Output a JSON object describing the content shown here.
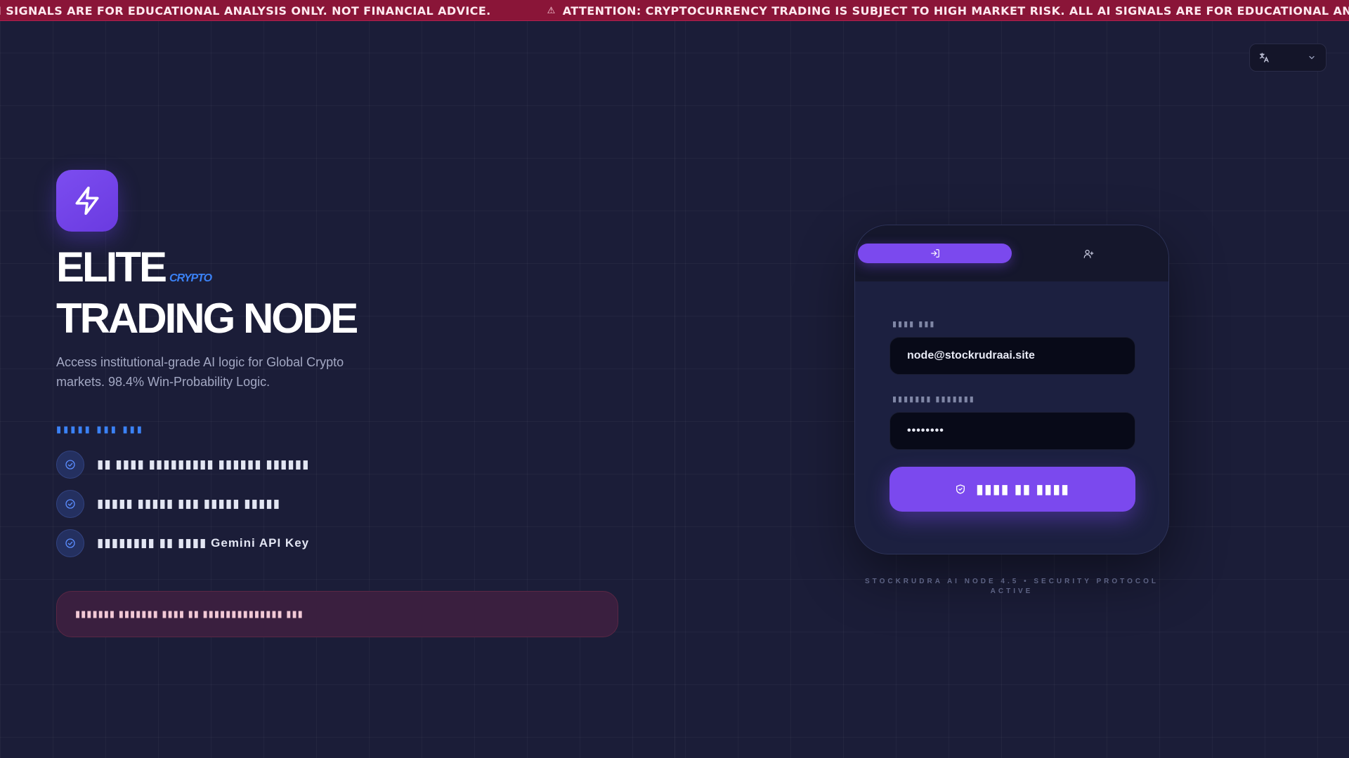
{
  "ticker": {
    "message": "ATTENTION: CRYPTOCURRENCY TRADING IS SUBJECT TO HIGH MARKET RISK. ALL AI SIGNALS ARE FOR EDUCATIONAL ANALYSIS ONLY. NOT FINANCIAL ADVICE.",
    "icon": "warning-icon"
  },
  "hero": {
    "logo_icon": "lightning-bolt-icon",
    "title_line1": "ELITE",
    "title_badge": "CRYPTO",
    "title_line2": "TRADING NODE",
    "subtitle": "Access institutional-grade AI logic for Global Crypto markets. 98.4% Win-Probability Logic.",
    "section_label": "▮▮▮▮▮ ▮▮▮ ▮▮▮",
    "features": [
      {
        "text": "▮▮ ▮▮▮▮ ▮▮▮▮▮▮▮▮▮ ▮▮▮▮▮▮ ▮▮▮▮▮▮",
        "icon": "check-icon"
      },
      {
        "text": "▮▮▮▮▮ ▮▮▮▮▮ ▮▮▮ ▮▮▮▮▮ ▮▮▮▮▮",
        "icon": "check-icon"
      },
      {
        "text": "▮▮▮▮▮▮▮▮ ▮▮ ▮▮▮▮ Gemini API Key",
        "icon": "check-icon"
      }
    ],
    "notice": "▮▮▮▮▮▮▮ ▮▮▮▮▮▮▮ ▮▮▮▮ ▮▮ ▮▮▮▮▮▮▮▮▮▮▮▮▮▮ ▮▮▮"
  },
  "language": {
    "icon": "translate-icon",
    "selected": "",
    "chevron": "chevron-down-icon"
  },
  "auth": {
    "tabs": [
      {
        "icon": "login-icon",
        "active": true
      },
      {
        "icon": "user-plus-icon",
        "active": false
      }
    ],
    "email_label": "▮▮▮▮ ▮▮▮",
    "email_value": "node@stockrudraai.site",
    "password_label": "▮▮▮▮▮▮▮ ▮▮▮▮▮▮▮",
    "password_value": "••••••••",
    "submit_icon": "shield-check-icon",
    "submit_label": "▮▮▮▮ ▮▮ ▮▮▮▮",
    "footer": "STOCKRUDRA AI NODE 4.5 • SECURITY PROTOCOL ACTIVE"
  },
  "colors": {
    "accent": "#7b49ee",
    "blue": "#3b82f6",
    "ticker_bg": "#8a1538",
    "page_bg": "#1b1d38"
  }
}
